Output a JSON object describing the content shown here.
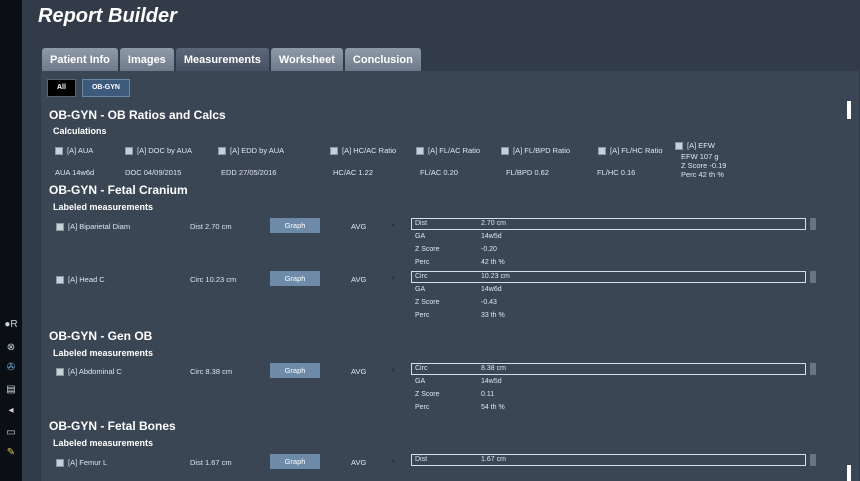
{
  "app": {
    "title": "Report Builder"
  },
  "tabs": [
    "Patient Info",
    "Images",
    "Measurements",
    "Worksheet",
    "Conclusion"
  ],
  "filters": [
    "All",
    "OB-GYN"
  ],
  "sections": {
    "ratios": {
      "title": "OB-GYN - OB Ratios and Calcs",
      "sub": "Calculations",
      "items": [
        {
          "label": "[A] AUA",
          "value": "AUA 14w6d"
        },
        {
          "label": "[A] DOC by AUA",
          "value": "DOC 04/09/2015"
        },
        {
          "label": "[A] EDD by AUA",
          "value": "EDD 27/05/2016"
        },
        {
          "label": "[A] HC/AC Ratio",
          "value": "HC/AC 1.22"
        },
        {
          "label": "[A] FL/AC Ratio",
          "value": "FL/AC 0.20"
        },
        {
          "label": "[A] FL/BPD Ratio",
          "value": "FL/BPD 0.62"
        },
        {
          "label": "[A] FL/HC Ratio",
          "value": "FL/HC 0.16"
        }
      ],
      "efw": {
        "label": "[A] EFW",
        "line1": "EFW 107 g",
        "line2": "Z Score -0.19",
        "line3": "Perc 42 th %"
      }
    },
    "cranium": {
      "title": "OB-GYN - Fetal Cranium",
      "sub": "Labeled measurements",
      "rows": [
        {
          "label": "[A] Biparietal Diam",
          "value": "Dist 2.70 cm",
          "button": "Graph",
          "method": "AVG",
          "box": [
            [
              "Dist",
              "2.70   cm"
            ],
            [
              "GA",
              "14w5d"
            ],
            [
              "Z Score",
              "-0.20"
            ],
            [
              "Perc",
              "42  th %"
            ]
          ]
        },
        {
          "label": "[A] Head C",
          "value": "Circ 10.23 cm",
          "button": "Graph",
          "method": "AVG",
          "box": [
            [
              "Circ",
              "10.23   cm"
            ],
            [
              "GA",
              "14w6d"
            ],
            [
              "Z Score",
              "-0.43"
            ],
            [
              "Perc",
              "33  th %"
            ]
          ]
        }
      ]
    },
    "genob": {
      "title": "OB-GYN - Gen OB",
      "sub": "Labeled measurements",
      "rows": [
        {
          "label": "[A] Abdominal C",
          "value": "Circ 8.38 cm",
          "button": "Graph",
          "method": "AVG",
          "box": [
            [
              "Circ",
              "8.38   cm"
            ],
            [
              "GA",
              "14w5d"
            ],
            [
              "Z Score",
              "0.11"
            ],
            [
              "Perc",
              "54  th %"
            ]
          ]
        }
      ]
    },
    "bones": {
      "title": "OB-GYN - Fetal Bones",
      "sub": "Labeled measurements",
      "rows": [
        {
          "label": "[A] Femur L",
          "value": "Dist 1.67 cm",
          "button": "Graph",
          "method": "AVG",
          "box": [
            [
              "Dist",
              "1.67   cm"
            ]
          ]
        }
      ]
    }
  },
  "leftbar": {
    "r_label": "R"
  }
}
